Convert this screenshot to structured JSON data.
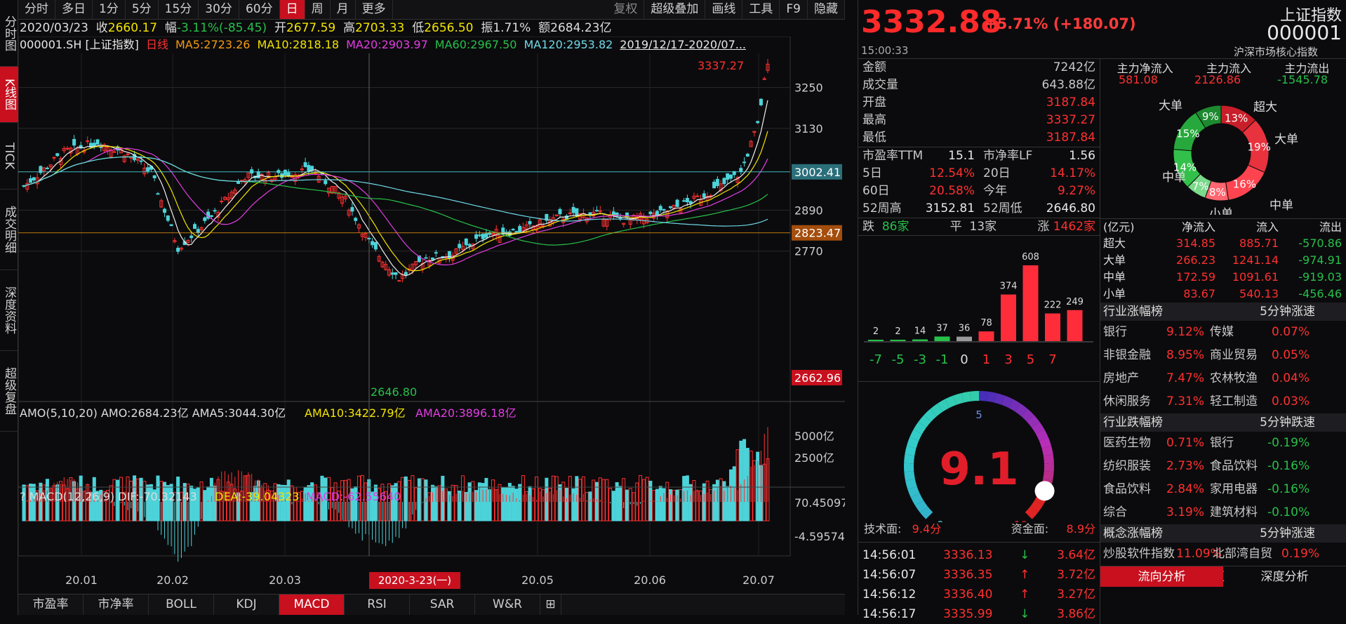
{
  "left_tabs": [
    "分时图",
    "K线图",
    "TICK",
    "成交明细",
    "深度资料",
    "超级复盘"
  ],
  "toolbar": {
    "left": [
      "分时",
      "多日",
      "1分",
      "5分",
      "15分",
      "30分",
      "60分",
      "日",
      "周",
      "月",
      "更多"
    ],
    "active": "日",
    "right": [
      "复权",
      "超级叠加",
      "画线",
      "工具",
      "F9",
      "隐藏"
    ]
  },
  "info": {
    "date": "2020/03/23",
    "close_label": "收",
    "close": "2660.17",
    "range_label": "幅",
    "range": "-3.11%(-85.45)",
    "open_label": "开",
    "open": "2677.59",
    "high_label": "高",
    "high": "2703.33",
    "low_label": "低",
    "low": "2656.50",
    "amp_label": "振",
    "amp": "1.71%",
    "amount_label": "额",
    "amount": "2684.23亿"
  },
  "ma_line": {
    "code": "000001.SH [上证指数]",
    "period": "日线",
    "ma5": "MA5:2723.26",
    "ma10": "MA10:2818.18",
    "ma20": "MA20:2903.97",
    "ma60": "MA60:2967.50",
    "ma120": "MA120:2953.82",
    "range": "2019/12/17-2020/07..."
  },
  "colors": {
    "up": "#ff3030",
    "down": "#4cd3d9",
    "ma5": "#f0f0f0",
    "ma10": "#f2e400",
    "ma20": "#e23de2",
    "ma60": "#27c04a",
    "ma120": "#6fd9e8"
  },
  "chart_data": {
    "type": "candlestick",
    "price_axis": {
      "ticks": [
        3250,
        3130,
        2890,
        2770
      ],
      "min": 2580,
      "max": 3350
    },
    "markers": {
      "max_label": "3337.27",
      "min_label": "2646.80",
      "line1": "3002.41",
      "line2": "2823.47",
      "cursor_price": "2662.96",
      "cursor_date": "2020-3-23(一)"
    },
    "x_ticks": [
      "20.01",
      "20.02",
      "20.03",
      "20.05",
      "20.06",
      "20.07"
    ],
    "volume": {
      "label": "AMO(5,10,20)",
      "amo": "AMO:2684.23亿",
      "ama5": "AMA5:3044.30亿",
      "ama10": "AMA10:3422.79亿",
      "ama20": "AMA20:3896.18亿",
      "ticks": [
        "5000亿",
        "2500亿"
      ]
    },
    "macd": {
      "label": "MACD(12,26,9)",
      "dif": "DIF:-70.32143",
      "dea": "DEA:-39.04323",
      "macd": "MACD:-62.55640",
      "ticks": [
        "70.45097",
        "-4.59574"
      ]
    }
  },
  "bottom_tabs": [
    "市盈率",
    "市净率",
    "BOLL",
    "KDJ",
    "MACD",
    "RSI",
    "SAR",
    "W&R"
  ],
  "bottom_active": "MACD",
  "quote": {
    "price": "3332.88",
    "change": "+5.71% (+180.07)",
    "name": "上证指数",
    "code": "000001",
    "time": "15:00:33",
    "sub": "沪深市场核心指数"
  },
  "stats": [
    [
      "金额",
      "7242亿"
    ],
    [
      "成交量",
      "643.88亿"
    ],
    [
      "开盘",
      "3187.84"
    ],
    [
      "最高",
      "3337.27"
    ],
    [
      "最低",
      "3187.84"
    ]
  ],
  "ratios": [
    [
      "市盈率TTM",
      "15.1",
      "市净率LF",
      "1.56"
    ],
    [
      "5日",
      "12.54%",
      "20日",
      "14.17%"
    ],
    [
      "60日",
      "20.58%",
      "今年",
      "9.27%"
    ],
    [
      "52周高",
      "3152.81",
      "52周低",
      "2646.80"
    ]
  ],
  "breadth": {
    "down_label": "跌",
    "down": "86家",
    "flat_label": "平",
    "flat": "13家",
    "up_label": "涨",
    "up": "1462家"
  },
  "dist": {
    "values": [
      2,
      2,
      14,
      37,
      36,
      78,
      374,
      608,
      222,
      249
    ],
    "labels": [
      "-7",
      "-5",
      "-3",
      "-1",
      "0",
      "1",
      "3",
      "5",
      "7"
    ]
  },
  "gauge": {
    "value": "9.1",
    "min": "0",
    "mid": "5",
    "max": "10",
    "tech_label": "技术面:",
    "tech": "9.4分",
    "fund_label": "资金面:",
    "fund": "8.9分"
  },
  "ticks": [
    [
      "14:56:01",
      "3336.13",
      "3.64亿",
      "down"
    ],
    [
      "14:56:07",
      "3336.35",
      "3.72亿",
      "up"
    ],
    [
      "14:56:12",
      "3336.40",
      "3.27亿",
      "up"
    ],
    [
      "14:56:17",
      "3335.99",
      "3.86亿",
      "down"
    ]
  ],
  "flow": {
    "headers": [
      "主力净流入",
      "主力流入",
      "主力流出"
    ],
    "values": [
      "581.08",
      "2126.86",
      "-1545.78"
    ],
    "pie": [
      {
        "name": "超大",
        "pct": "13%"
      },
      {
        "name": "大单",
        "pct": "19%"
      },
      {
        "name": "中单",
        "pct": "16%"
      },
      {
        "name": "小单",
        "pct": "8%"
      },
      {
        "name": "小单",
        "pct": "7%"
      },
      {
        "name": "中单",
        "pct": "14%"
      },
      {
        "name": "大单",
        "pct": "15%"
      },
      {
        "name": "超大",
        "pct": "9%"
      }
    ],
    "pie_labels": [
      "大单",
      "超大",
      "大单",
      "中单",
      "中单",
      "小单"
    ],
    "table_headers": [
      "(亿元)",
      "净流入",
      "流入",
      "流出"
    ],
    "rows": [
      [
        "超大",
        "314.85",
        "885.71",
        "-570.86"
      ],
      [
        "大单",
        "266.23",
        "1241.14",
        "-974.91"
      ],
      [
        "中单",
        "172.59",
        "1091.61",
        "-919.03"
      ],
      [
        "小单",
        "83.67",
        "540.13",
        "-456.46"
      ]
    ]
  },
  "industry_up": {
    "title": "行业涨幅榜",
    "title2": "5分钟涨速",
    "rows": [
      [
        "银行",
        "9.12%",
        "传媒",
        "0.07%"
      ],
      [
        "非银金融",
        "8.95%",
        "商业贸易",
        "0.05%"
      ],
      [
        "房地产",
        "7.47%",
        "农林牧渔",
        "0.04%"
      ],
      [
        "休闲服务",
        "7.31%",
        "轻工制造",
        "0.03%"
      ]
    ]
  },
  "industry_down": {
    "title": "行业跌幅榜",
    "title2": "5分钟跌速",
    "rows": [
      [
        "医药生物",
        "0.71%",
        "银行",
        "-0.19%"
      ],
      [
        "纺织服装",
        "2.73%",
        "食品饮料",
        "-0.16%"
      ],
      [
        "食品饮料",
        "2.84%",
        "家用电器",
        "-0.16%"
      ],
      [
        "综合",
        "3.19%",
        "建筑材料",
        "-0.10%"
      ]
    ]
  },
  "concept": {
    "title": "概念涨幅榜",
    "title2": "5分钟涨速",
    "row": [
      "炒股软件指数",
      "11.09%",
      "北部湾自贸区",
      "0.19%"
    ]
  },
  "bottom_right": [
    "流向分析",
    "深度分析"
  ]
}
